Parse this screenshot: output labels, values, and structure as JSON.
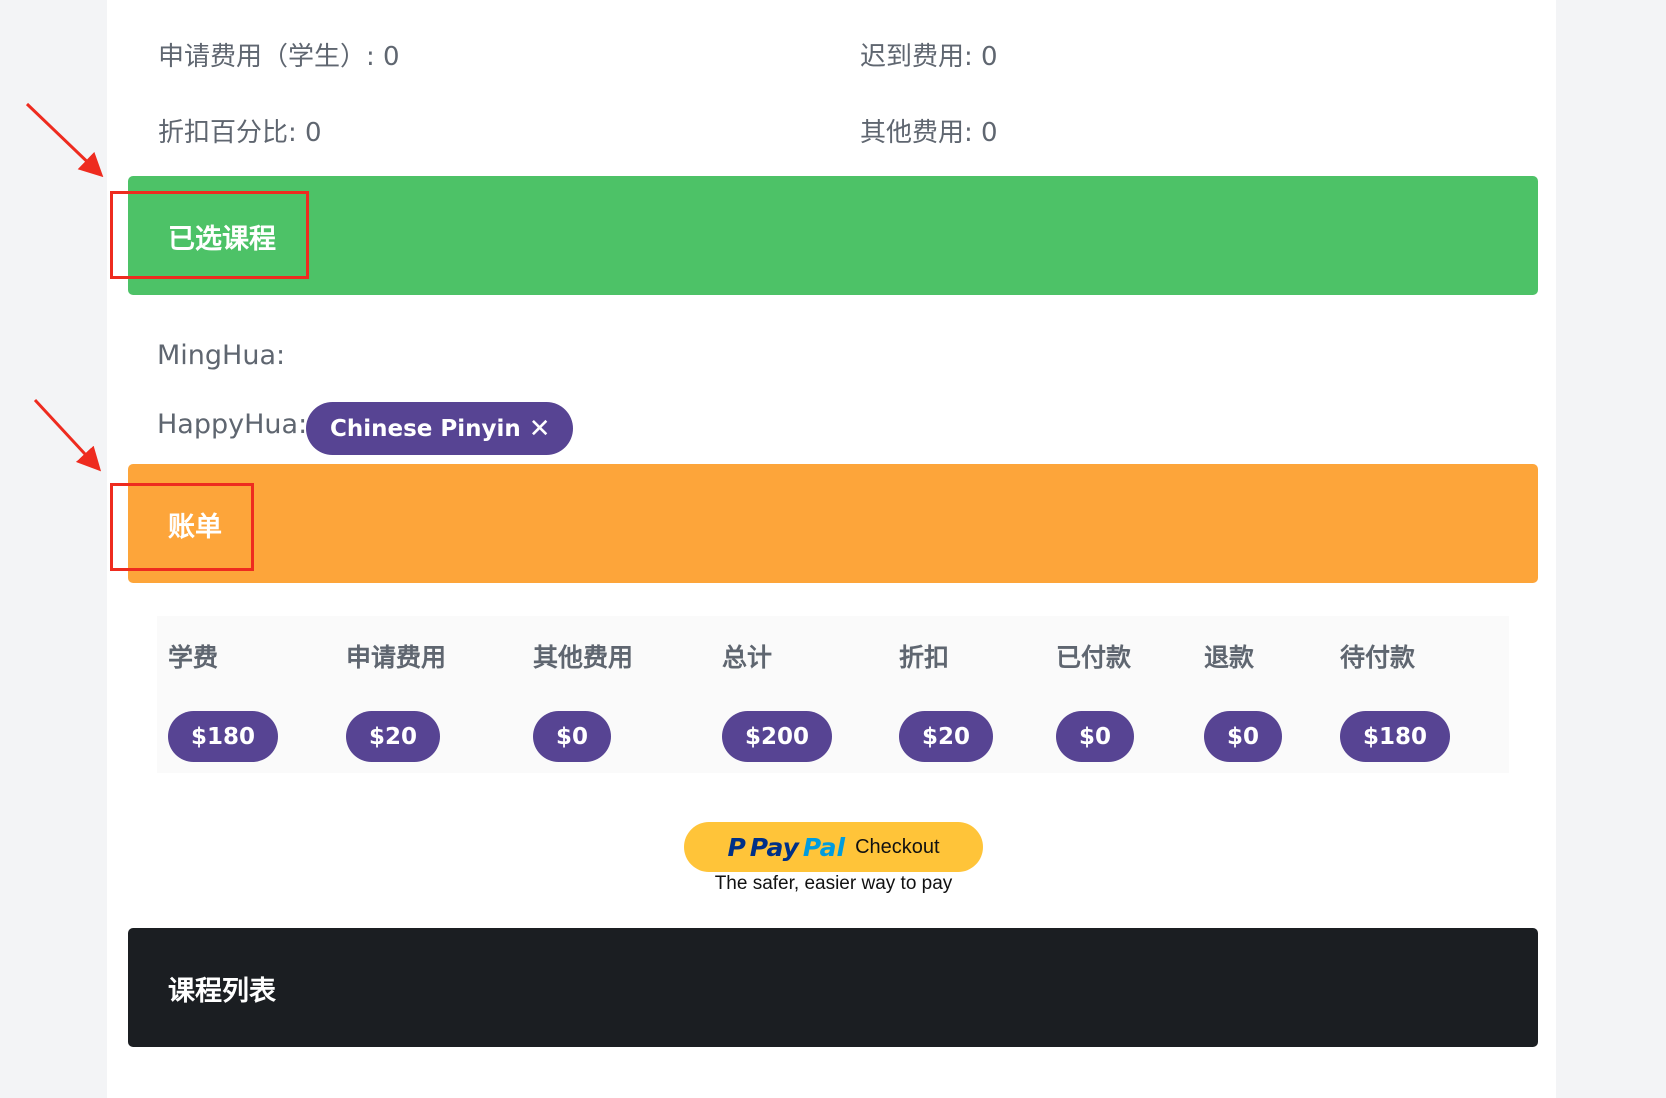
{
  "fees_info": {
    "application_fee_student": "申请费用（学生）: 0",
    "late_fee": "迟到费用: 0",
    "discount_percent": "折扣百分比: 0",
    "other_fee": "其他费用: 0"
  },
  "selected_courses": {
    "title": "已选课程",
    "color": "#4dc267",
    "students": [
      {
        "name": "MingHua:",
        "courses": []
      },
      {
        "name": "HappyHua:",
        "courses": [
          {
            "label": "Chinese Pinyin",
            "remove_icon": "close-icon"
          }
        ]
      }
    ]
  },
  "bill": {
    "title": "账单",
    "color": "#fda53a",
    "columns": [
      {
        "header": "学费",
        "amount": "$180"
      },
      {
        "header": "申请费用",
        "amount": "$20"
      },
      {
        "header": "其他费用",
        "amount": "$0"
      },
      {
        "header": "总计",
        "amount": "$200"
      },
      {
        "header": "折扣",
        "amount": "$20"
      },
      {
        "header": "已付款",
        "amount": "$0"
      },
      {
        "header": "退款",
        "amount": "$0"
      },
      {
        "header": "待付款",
        "amount": "$180"
      }
    ],
    "pill_color": "#574493"
  },
  "paypal": {
    "logo_p": "P",
    "logo_pay": "Pay",
    "logo_pal": "Pal",
    "checkout_label": "Checkout",
    "tagline": "The safer, easier way to pay",
    "color": "#ffc439"
  },
  "course_list": {
    "title": "课程列表",
    "color": "#1b1e22"
  },
  "annotations": {
    "highlight_color": "#ee2b1f"
  }
}
